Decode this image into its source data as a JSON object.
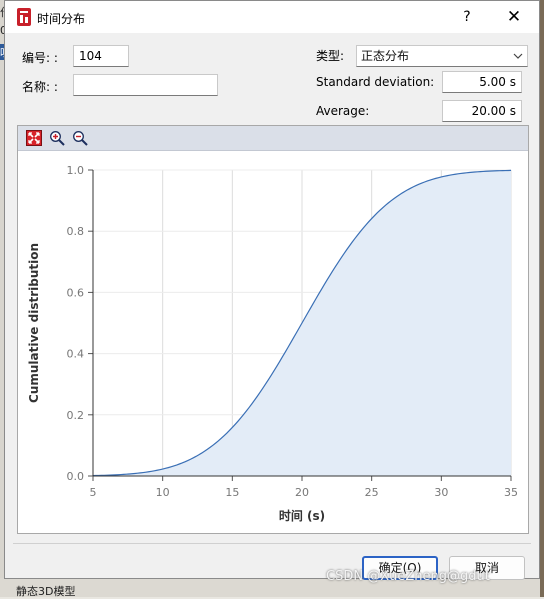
{
  "window": {
    "title": "时间分布",
    "help_label": "?",
    "close_label": "✕"
  },
  "form": {
    "id_label": "编号: :",
    "id_value": "104",
    "name_label": "名称: :",
    "name_value": "",
    "type_label": "类型:",
    "type_value": "正态分布",
    "std_label": "Standard deviation:",
    "std_value": "5.00 s",
    "avg_label": "Average:",
    "avg_value": "20.00 s"
  },
  "toolbar": {
    "icons": [
      "reset-zoom-icon",
      "zoom-in-icon",
      "zoom-out-icon"
    ]
  },
  "chart_data": {
    "type": "area",
    "title": "",
    "xlabel": "时间 (s)",
    "ylabel": "Cumulative distribution",
    "xlim": [
      5,
      35
    ],
    "ylim": [
      0,
      1
    ],
    "x_ticks": [
      "5",
      "10",
      "15",
      "20",
      "25",
      "30",
      "35"
    ],
    "y_ticks": [
      "0.0",
      "0.2",
      "0.4",
      "0.6",
      "0.8",
      "1.0"
    ],
    "grid": true,
    "legend": "none",
    "series": [
      {
        "distribution": "normal CDF",
        "mean": 20,
        "std": 5,
        "line_color": "#3a6fb5",
        "fill_color": "#e3ecf7"
      }
    ]
  },
  "buttons": {
    "ok": "确定(O)",
    "cancel": "取消"
  },
  "background": {
    "left_fragments": [
      "作",
      "0",
      "叹"
    ],
    "bottom_text": "静态3D模型",
    "watermark": "CSDN @XueZheng@gdut"
  }
}
